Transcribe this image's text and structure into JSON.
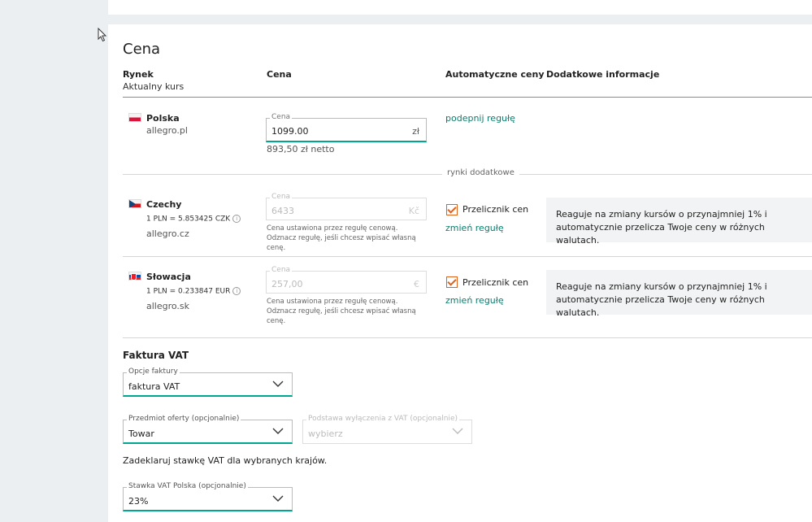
{
  "section": {
    "title": "Cena",
    "columns": {
      "market": "Rynek",
      "market_sub": "Aktualny kurs",
      "price": "Cena",
      "auto_prices": "Automatyczne ceny",
      "extra_info": "Dodatkowe informacje"
    },
    "additional_markets_label": "rynki dodatkowe"
  },
  "markets": [
    {
      "name": "Polska",
      "domain": "allegro.pl",
      "price_legend": "Cena",
      "price_value": "1099.00",
      "unit": "zł",
      "netto": "893,50 zł netto",
      "link": "podepnij regułę"
    },
    {
      "name": "Czechy",
      "rate": "1 PLN = 5.853425 CZK",
      "domain": "allegro.cz",
      "price_legend": "Cena",
      "price_value": "6433",
      "unit": "Kč",
      "helper": "Cena ustawiona przez regułę cenową. Odznacz regułę, jeśli chcesz wpisać własną cenę.",
      "checkbox_label": "Przelicznik cen",
      "link": "zmień regułę",
      "info": "Reaguje na zmiany kursów o przynajmniej 1% i automatycznie przelicza Twoje ceny w różnych walutach."
    },
    {
      "name": "Słowacja",
      "rate": "1 PLN = 0.233847 EUR",
      "domain": "allegro.sk",
      "price_legend": "Cena",
      "price_value": "257,00",
      "unit": "€",
      "helper": "Cena ustawiona przez regułę cenową. Odznacz regułę, jeśli chcesz wpisać własną cenę.",
      "checkbox_label": "Przelicznik cen",
      "link": "zmień regułę",
      "info": "Reaguje na zmiany kursów o przynajmniej 1% i automatycznie przelicza Twoje ceny w różnych walutach."
    }
  ],
  "vat": {
    "title": "Faktura VAT",
    "invoice_options_legend": "Opcje faktury",
    "invoice_options_value": "faktura VAT",
    "subject_legend": "Przedmiot oferty (opcjonalnie)",
    "subject_value": "Towar",
    "exemption_legend": "Podstawa wyłączenia z VAT (opcjonalnie)",
    "exemption_placeholder": "wybierz",
    "declare_text": "Zadeklaruj stawkę VAT dla wybranych krajów.",
    "rate_pl_legend": "Stawka VAT Polska (opcjonalnie)",
    "rate_pl_value": "23%"
  },
  "icons": {
    "cursor": "mouse-pointer-icon",
    "info": "info-icon",
    "chevron": "chevron-down-icon",
    "check": "checkmark-icon"
  },
  "colors": {
    "accent_green": "#00a790",
    "link_green": "#0a7c6d",
    "checkbox_orange": "#e0611a",
    "background": "#eceff1"
  }
}
